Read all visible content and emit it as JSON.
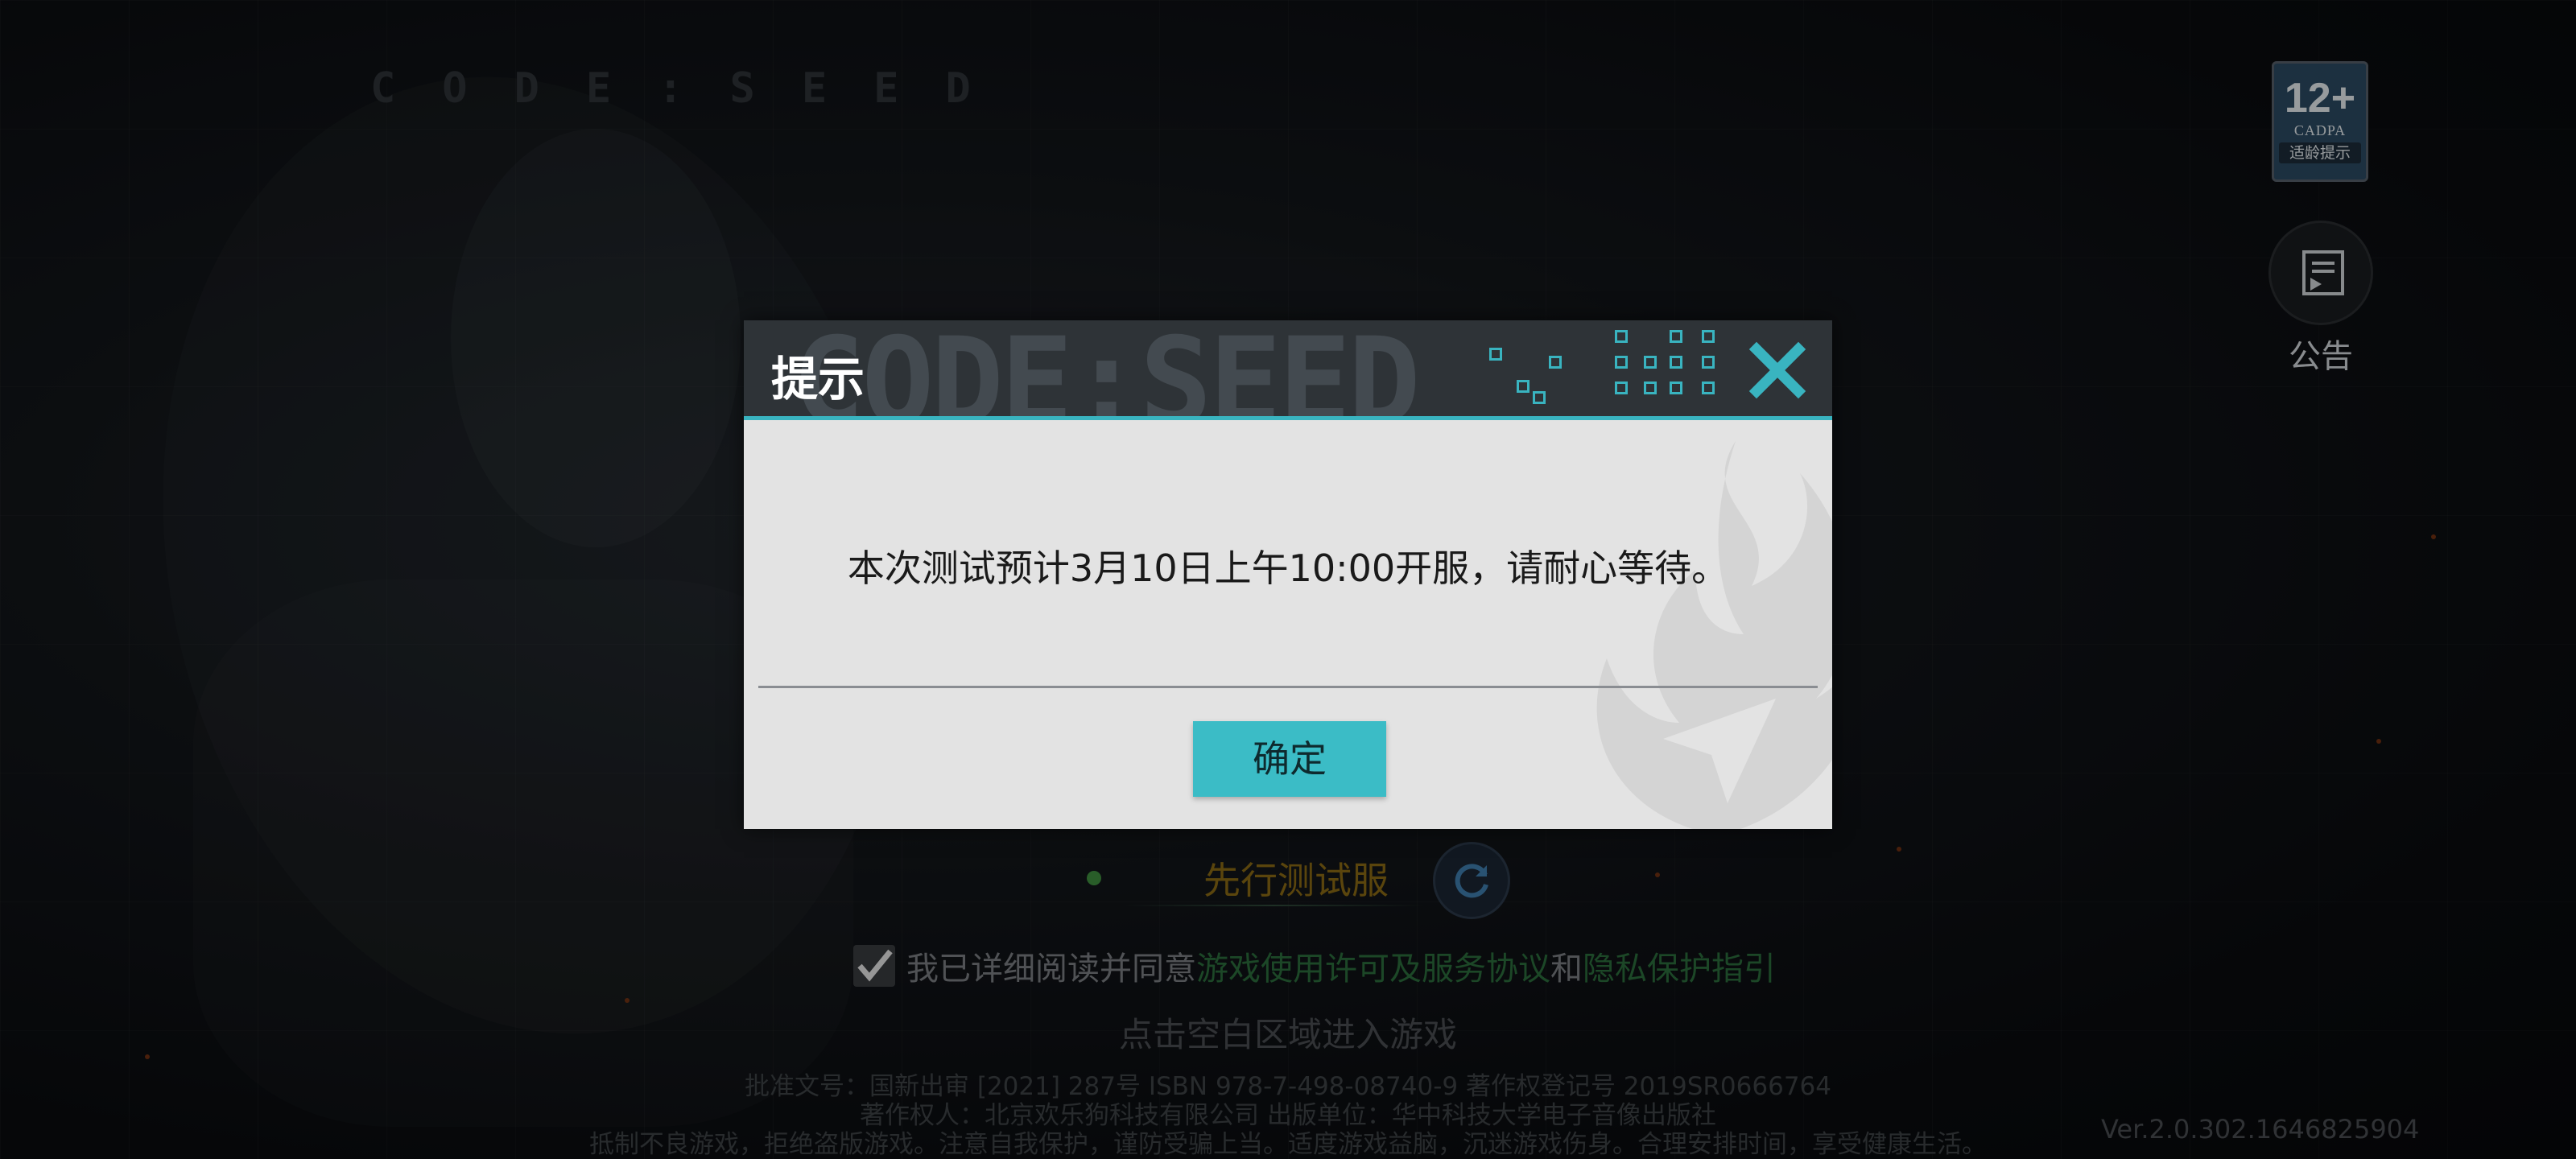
{
  "game": {
    "logo_text": "CODE:SEED"
  },
  "age_badge": {
    "rating": "12+",
    "org": "CADPA",
    "label": "适龄提示"
  },
  "notice": {
    "label": "公告"
  },
  "server": {
    "name": "先行测试服"
  },
  "agreement": {
    "prefix": "我已详细阅读并同意",
    "link1": "游戏使用许可及服务协议",
    "conj": "和",
    "link2": "隐私保护指引",
    "checked": true
  },
  "tap_hint": "点击空白区域进入游戏",
  "legal": {
    "line1": "批准文号：国新出审 [2021] 287号 ISBN 978-7-498-08740-9 著作权登记号 2019SR0666764",
    "line2": "著作权人：北京欢乐狗科技有限公司 出版单位：华中科技大学电子音像出版社",
    "line3": "抵制不良游戏，拒绝盗版游戏。注意自我保护，谨防受骗上当。适度游戏益脑，沉迷游戏伤身。合理安排时间，享受健康生活。"
  },
  "version": "Ver.2.0.302.1646825904",
  "dialog": {
    "title": "提示",
    "watermark": "CODE:SEED",
    "message": "本次测试预计3月10日上午10:00开服，请耐心等待。",
    "confirm_label": "确定"
  },
  "colors": {
    "accent": "#39b4c0",
    "header_bg": "#2e3337",
    "dialog_bg": "#e3e3e3",
    "server_text": "#8a6a14",
    "link": "#2b6d3c"
  },
  "icons": {
    "close": "close-icon",
    "notice": "notice-icon",
    "refresh": "refresh-icon",
    "checkbox": "checkmark-icon"
  }
}
